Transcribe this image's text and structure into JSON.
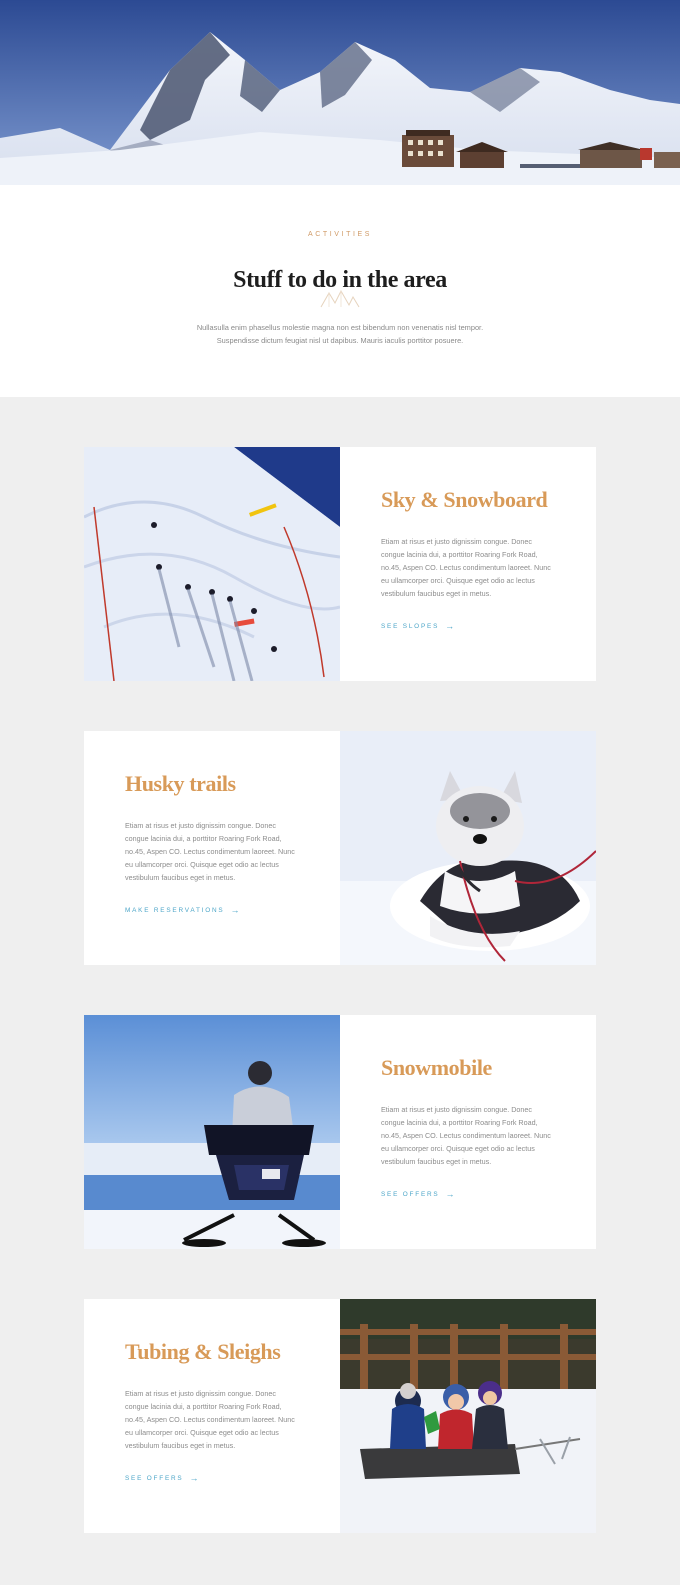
{
  "intro": {
    "eyebrow": "ACTIVITIES",
    "headline": "Stuff to do in the area",
    "lede": "Nullasulla enim phasellus molestie magna non est bibendum non venenatis nisl tempor. Suspendisse dictum feugiat nisl ut dapibus. Mauris iaculis porttitor posuere."
  },
  "colors": {
    "accent_gold": "#d89a58",
    "link_blue": "#4da6c8",
    "page_background": "#efefef"
  },
  "activities": [
    {
      "title": "Sky & Snowboard",
      "body": "Etiam at risus et justo dignissim congue. Donec congue lacinia dui, a porttitor Roaring Fork Road, no.45, Aspen CO. Lectus condimentum laoreet. Nunc eu ullamcorper orci. Quisque eget odio ac lectus vestibulum faucibus eget in metus.",
      "link": "SEE SLOPES",
      "photo": "ski-slope-photo"
    },
    {
      "title": "Husky trails",
      "body": "Etiam at risus et justo dignissim congue. Donec congue lacinia dui, a porttitor Roaring Fork Road, no.45, Aspen CO. Lectus condimentum laoreet. Nunc eu ullamcorper orci. Quisque eget odio ac lectus vestibulum faucibus eget in metus.",
      "link": "MAKE RESERVATIONS",
      "photo": "husky-photo"
    },
    {
      "title": "Snowmobile",
      "body": "Etiam at risus et justo dignissim congue. Donec congue lacinia dui, a porttitor Roaring Fork Road, no.45, Aspen CO. Lectus condimentum laoreet. Nunc eu ullamcorper orci. Quisque eget odio ac lectus vestibulum faucibus eget in metus.",
      "link": "SEE OFFERS",
      "photo": "snowmobile-photo"
    },
    {
      "title": "Tubing & Sleighs",
      "body": "Etiam at risus et justo dignissim congue. Donec congue lacinia dui, a porttitor Roaring Fork Road, no.45, Aspen CO. Lectus condimentum laoreet. Nunc eu ullamcorper orci. Quisque eget odio ac lectus vestibulum faucibus eget in metus.",
      "link": "SEE OFFERS",
      "photo": "sleigh-photo"
    }
  ],
  "icons": {
    "arrow": "arrow-right-icon",
    "brand_mark": "mountain-mark-icon"
  }
}
